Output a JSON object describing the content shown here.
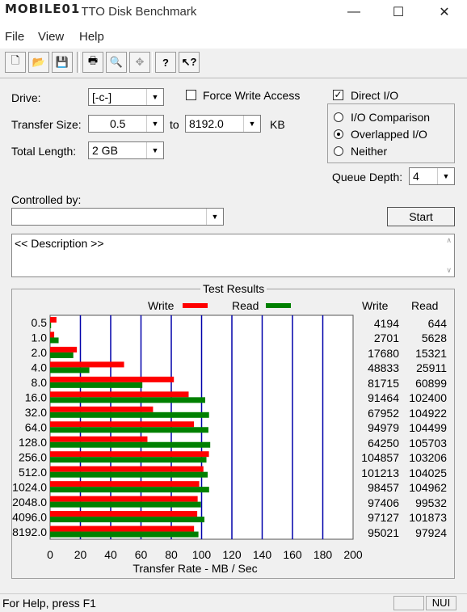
{
  "window": {
    "title": "Untitled - ATTO Disk Benchmark",
    "watermark": "MOBILE01",
    "controls": {
      "minimize": "—",
      "maximize": "☐",
      "close": "✕"
    }
  },
  "menu": {
    "file": "File",
    "view": "View",
    "help": "Help"
  },
  "toolbar": {
    "icons": [
      "new-icon",
      "open-icon",
      "save-icon",
      "print-icon",
      "print-preview-icon",
      "move-icon",
      "help-icon",
      "context-help-icon"
    ],
    "glyphs": {
      "new": "🗋",
      "open": "📂",
      "save": "💾",
      "print": "🖶",
      "preview": "🔍",
      "move": "✥",
      "help": "?",
      "context_help": "↖?"
    }
  },
  "settings": {
    "drive_label": "Drive:",
    "drive_value": "[-c-]",
    "force_write_label": "Force Write Access",
    "force_write_checked": false,
    "direct_io_label": "Direct I/O",
    "direct_io_checked": true,
    "transfer_size_label": "Transfer Size:",
    "transfer_from": "0.5",
    "to_label": "to",
    "transfer_to": "8192.0",
    "kb_label": "KB",
    "total_length_label": "Total Length:",
    "total_length_value": "2 GB",
    "io_comparison_label": "I/O Comparison",
    "overlapped_io_label": "Overlapped I/O",
    "neither_label": "Neither",
    "selected_mode": "Overlapped I/O",
    "queue_depth_label": "Queue Depth:",
    "queue_depth_value": "4",
    "controlled_by_label": "Controlled by:",
    "controlled_by_value": "",
    "start_label": "Start",
    "description": "<< Description >>"
  },
  "results": {
    "title": "Test Results",
    "write_legend": "Write",
    "read_legend": "Read",
    "write_header": "Write",
    "read_header": "Read",
    "write_color": "#ff0000",
    "read_color": "#008000",
    "grid_color": "#0000aa"
  },
  "chart_data": {
    "type": "bar",
    "orientation": "horizontal",
    "xlabel": "Transfer Rate - MB / Sec",
    "xlim": [
      0,
      200
    ],
    "xticks": [
      0,
      20,
      40,
      60,
      80,
      100,
      120,
      140,
      160,
      180,
      200
    ],
    "categories": [
      "0.5",
      "1.0",
      "2.0",
      "4.0",
      "8.0",
      "16.0",
      "32.0",
      "64.0",
      "128.0",
      "256.0",
      "512.0",
      "1024.0",
      "2048.0",
      "4096.0",
      "8192.0"
    ],
    "series": [
      {
        "name": "Write",
        "values": [
          4194,
          2701,
          17680,
          48833,
          81715,
          91464,
          67952,
          94979,
          64250,
          104857,
          101213,
          98457,
          97406,
          97127,
          95021
        ]
      },
      {
        "name": "Read",
        "values": [
          644,
          5628,
          15321,
          25911,
          60899,
          102400,
          104922,
          104499,
          105703,
          103206,
          104025,
          104962,
          99532,
          101873,
          97924
        ]
      }
    ],
    "legend": "top"
  },
  "status": {
    "help_text": "For Help, press F1",
    "indicator": "NUI"
  }
}
